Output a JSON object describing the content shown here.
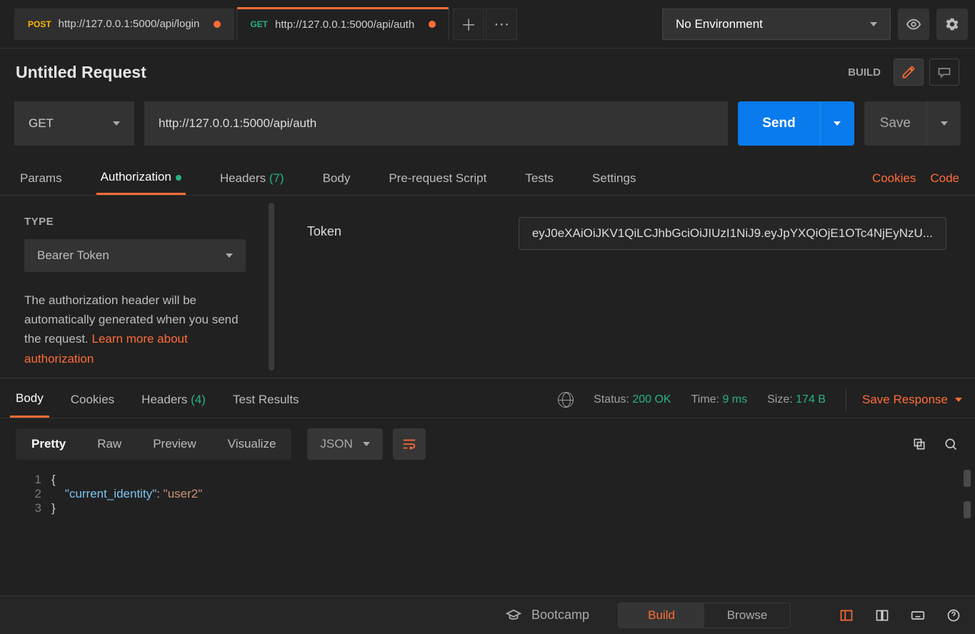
{
  "topbar": {
    "tabs": [
      {
        "method": "POST",
        "url": "http://127.0.0.1:5000/api/login",
        "dirty": true
      },
      {
        "method": "GET",
        "url": "http://127.0.0.1:5000/api/auth",
        "dirty": true
      }
    ],
    "env_label": "No Environment"
  },
  "title": "Untitled Request",
  "build_mode": "BUILD",
  "request": {
    "method": "GET",
    "url": "http://127.0.0.1:5000/api/auth",
    "send_label": "Send",
    "save_label": "Save"
  },
  "req_tabs": {
    "params": "Params",
    "authorization": "Authorization",
    "headers": "Headers",
    "headers_count": "(7)",
    "body": "Body",
    "prerequest": "Pre-request Script",
    "tests": "Tests",
    "settings": "Settings",
    "cookies": "Cookies",
    "code": "Code"
  },
  "auth": {
    "type_label": "TYPE",
    "type_value": "Bearer Token",
    "desc_pre": "The authorization header will be automatically generated when you send the request. ",
    "learn_more": "Learn more about authorization",
    "token_label": "Token",
    "token_value": "eyJ0eXAiOiJKV1QiLCJhbGciOiJIUzI1NiJ9.eyJpYXQiOjE1OTc4NjEyNzU..."
  },
  "resp_tabs": {
    "body": "Body",
    "cookies": "Cookies",
    "headers": "Headers",
    "headers_count": "(4)",
    "test_results": "Test Results",
    "status_label": "Status:",
    "status_value": "200 OK",
    "time_label": "Time:",
    "time_value": "9 ms",
    "size_label": "Size:",
    "size_value": "174 B",
    "save_response": "Save Response"
  },
  "format": {
    "pretty": "Pretty",
    "raw": "Raw",
    "preview": "Preview",
    "visualize": "Visualize",
    "lang": "JSON"
  },
  "response_body": {
    "line1": "{",
    "line2_key": "\"current_identity\"",
    "line2_sep": ": ",
    "line2_val": "\"user2\"",
    "line3": "}"
  },
  "footer": {
    "bootcamp": "Bootcamp",
    "build": "Build",
    "browse": "Browse"
  }
}
